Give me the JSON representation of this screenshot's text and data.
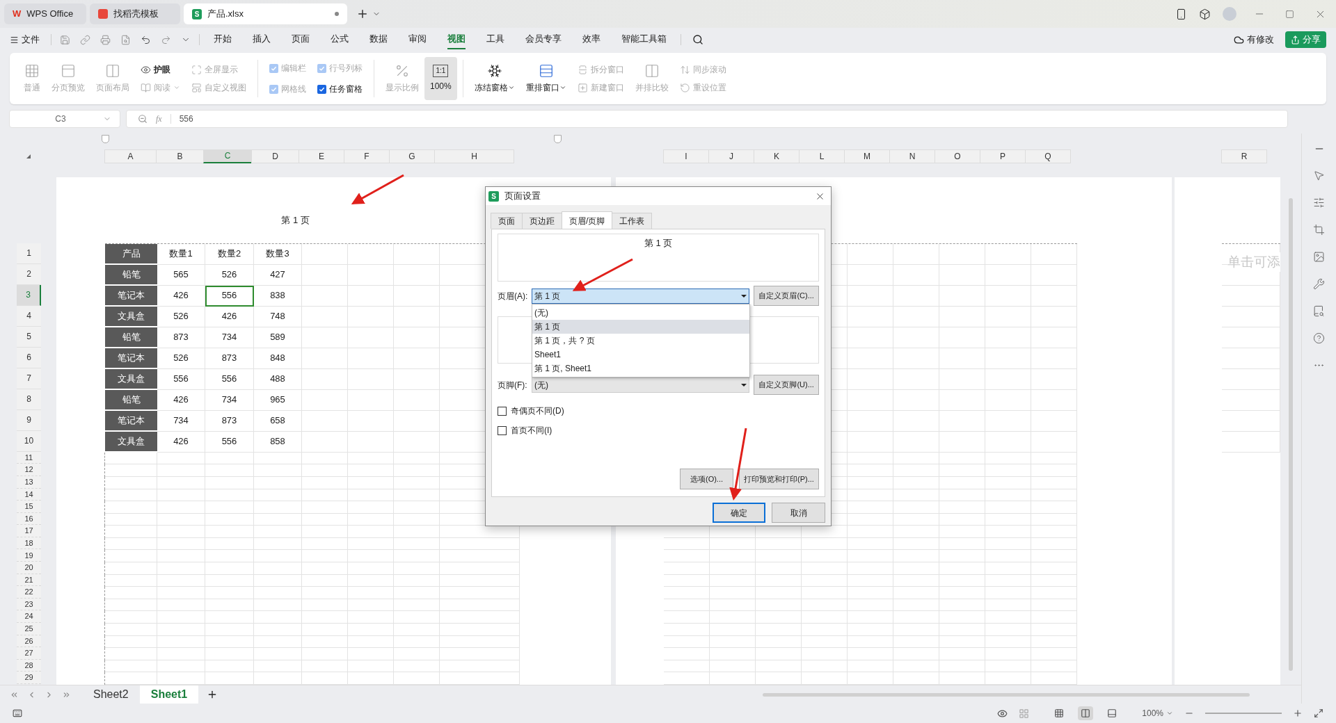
{
  "title_tabs": [
    {
      "label": "WPS Office",
      "kind": "wps",
      "logo": "W",
      "selected": false
    },
    {
      "label": "找稻壳模板",
      "kind": "docer",
      "selected": false
    },
    {
      "label": "产品.xlsx",
      "kind": "sheet",
      "logo": "S",
      "selected": true
    }
  ],
  "menu": {
    "file": "文件",
    "items": [
      {
        "label": "开始",
        "selected": false
      },
      {
        "label": "插入",
        "selected": false
      },
      {
        "label": "页面",
        "selected": false
      },
      {
        "label": "公式",
        "selected": false
      },
      {
        "label": "数据",
        "selected": false
      },
      {
        "label": "审阅",
        "selected": false
      },
      {
        "label": "视图",
        "selected": true
      },
      {
        "label": "工具",
        "selected": false
      },
      {
        "label": "会员专享",
        "selected": false
      },
      {
        "label": "效率",
        "selected": false
      },
      {
        "label": "智能工具箱",
        "selected": false
      }
    ],
    "save_status": "有修改",
    "share": "分享"
  },
  "ribbon": [
    [
      {
        "kind": "big",
        "label": "普通",
        "disabled": true,
        "selected": false
      },
      {
        "kind": "big",
        "label": "分页预览",
        "disabled": true,
        "selected": false
      },
      {
        "kind": "big",
        "label": "页面布局",
        "disabled": true,
        "selected": false
      },
      {
        "kind": "stack",
        "rows": [
          {
            "label": "护眼",
            "disabled": false,
            "dropdown": false
          },
          {
            "label": "阅读",
            "disabled": true,
            "dropdown": true
          }
        ]
      },
      {
        "kind": "stack",
        "rows": [
          {
            "label": "全屏显示",
            "disabled": true,
            "dropdown": false
          },
          {
            "label": "自定义视图",
            "disabled": true,
            "dropdown": false
          }
        ]
      }
    ],
    [
      {
        "kind": "checks",
        "rows": [
          {
            "label": "编辑栏",
            "checked": true,
            "disabled": true
          },
          {
            "label": "网格线",
            "checked": true,
            "disabled": true
          }
        ]
      },
      {
        "kind": "checks",
        "rows": [
          {
            "label": "行号列标",
            "checked": true,
            "disabled": true
          },
          {
            "label": "任务窗格",
            "checked": true,
            "disabled": false
          }
        ]
      }
    ],
    [
      {
        "kind": "big",
        "label": "显示比例",
        "disabled": true,
        "selected": false
      },
      {
        "kind": "big",
        "icon_text": "1:1",
        "label": "100%",
        "disabled": false,
        "selected": true
      }
    ],
    [
      {
        "kind": "big",
        "label": "冻结窗格",
        "disabled": false,
        "selected": false,
        "dropdown": true
      },
      {
        "kind": "big",
        "label": "重排窗口",
        "disabled": false,
        "selected": false,
        "dropdown": true
      },
      {
        "kind": "stack",
        "rows": [
          {
            "label": "拆分窗口",
            "disabled": true,
            "dropdown": false
          },
          {
            "label": "新建窗口",
            "disabled": true,
            "dropdown": false
          }
        ]
      },
      {
        "kind": "big",
        "label": "并排比较",
        "disabled": true,
        "selected": false
      },
      {
        "kind": "stack",
        "rows": [
          {
            "label": "同步滚动",
            "disabled": true,
            "dropdown": false
          },
          {
            "label": "重设位置",
            "disabled": true,
            "dropdown": false
          }
        ]
      }
    ]
  ],
  "name_box": "C3",
  "formula_label": "fx",
  "formula": "556",
  "columns_left": [
    {
      "label": "A",
      "selected": false
    },
    {
      "label": "B",
      "selected": false
    },
    {
      "label": "C",
      "selected": true
    },
    {
      "label": "D",
      "selected": false
    },
    {
      "label": "E",
      "selected": false
    },
    {
      "label": "F",
      "selected": false
    },
    {
      "label": "G",
      "selected": false
    },
    {
      "label": "H",
      "selected": false
    }
  ],
  "columns_right": [
    {
      "label": "I",
      "selected": false
    },
    {
      "label": "J",
      "selected": false
    },
    {
      "label": "K",
      "selected": false
    },
    {
      "label": "L",
      "selected": false
    },
    {
      "label": "M",
      "selected": false
    },
    {
      "label": "N",
      "selected": false
    },
    {
      "label": "O",
      "selected": false
    },
    {
      "label": "P",
      "selected": false
    },
    {
      "label": "Q",
      "selected": false
    }
  ],
  "columns_far": [
    {
      "label": "R",
      "selected": false
    }
  ],
  "page_header": "第 1 页",
  "far_page_hint": "单击可添",
  "rows": [
    {
      "num": "1",
      "selected": false,
      "cells": [
        {
          "text": "产品",
          "selected": false
        },
        {
          "text": "数量1",
          "selected": false
        },
        {
          "text": "数量2",
          "selected": false
        },
        {
          "text": "数量3",
          "selected": false
        }
      ]
    },
    {
      "num": "2",
      "selected": false,
      "cells": [
        {
          "text": "铅笔",
          "selected": false
        },
        {
          "text": "565",
          "selected": false
        },
        {
          "text": "526",
          "selected": false
        },
        {
          "text": "427",
          "selected": false
        }
      ]
    },
    {
      "num": "3",
      "selected": true,
      "cells": [
        {
          "text": "笔记本",
          "selected": false
        },
        {
          "text": "426",
          "selected": false
        },
        {
          "text": "556",
          "selected": true
        },
        {
          "text": "838",
          "selected": false
        }
      ]
    },
    {
      "num": "4",
      "selected": false,
      "cells": [
        {
          "text": "文具盒",
          "selected": false
        },
        {
          "text": "526",
          "selected": false
        },
        {
          "text": "426",
          "selected": false
        },
        {
          "text": "748",
          "selected": false
        }
      ]
    },
    {
      "num": "5",
      "selected": false,
      "cells": [
        {
          "text": "铅笔",
          "selected": false
        },
        {
          "text": "873",
          "selected": false
        },
        {
          "text": "734",
          "selected": false
        },
        {
          "text": "589",
          "selected": false
        }
      ]
    },
    {
      "num": "6",
      "selected": false,
      "cells": [
        {
          "text": "笔记本",
          "selected": false
        },
        {
          "text": "526",
          "selected": false
        },
        {
          "text": "873",
          "selected": false
        },
        {
          "text": "848",
          "selected": false
        }
      ]
    },
    {
      "num": "7",
      "selected": false,
      "cells": [
        {
          "text": "文具盒",
          "selected": false
        },
        {
          "text": "556",
          "selected": false
        },
        {
          "text": "556",
          "selected": false
        },
        {
          "text": "488",
          "selected": false
        }
      ]
    },
    {
      "num": "8",
      "selected": false,
      "cells": [
        {
          "text": "铅笔",
          "selected": false
        },
        {
          "text": "426",
          "selected": false
        },
        {
          "text": "734",
          "selected": false
        },
        {
          "text": "965",
          "selected": false
        }
      ]
    },
    {
      "num": "9",
      "selected": false,
      "cells": [
        {
          "text": "笔记本",
          "selected": false
        },
        {
          "text": "734",
          "selected": false
        },
        {
          "text": "873",
          "selected": false
        },
        {
          "text": "658",
          "selected": false
        }
      ]
    },
    {
      "num": "10",
      "selected": false,
      "cells": [
        {
          "text": "文具盒",
          "selected": false
        },
        {
          "text": "426",
          "selected": false
        },
        {
          "text": "556",
          "selected": false
        },
        {
          "text": "858",
          "selected": false
        }
      ]
    }
  ],
  "empty_rows": [
    {
      "num": "11",
      "selected": false
    },
    {
      "num": "12",
      "selected": false
    },
    {
      "num": "13",
      "selected": false
    },
    {
      "num": "14",
      "selected": false
    },
    {
      "num": "15",
      "selected": false
    },
    {
      "num": "16",
      "selected": false
    },
    {
      "num": "17",
      "selected": false
    },
    {
      "num": "18",
      "selected": false
    },
    {
      "num": "19",
      "selected": false
    },
    {
      "num": "20",
      "selected": false
    },
    {
      "num": "21",
      "selected": false
    },
    {
      "num": "22",
      "selected": false
    },
    {
      "num": "23",
      "selected": false
    },
    {
      "num": "24",
      "selected": false
    },
    {
      "num": "25",
      "selected": false
    },
    {
      "num": "26",
      "selected": false
    },
    {
      "num": "27",
      "selected": false
    },
    {
      "num": "28",
      "selected": false
    },
    {
      "num": "29",
      "selected": false
    }
  ],
  "dialog": {
    "logo": "S",
    "title": "页面设置",
    "tabs": [
      {
        "label": "页面",
        "selected": false
      },
      {
        "label": "页边距",
        "selected": false
      },
      {
        "label": "页眉/页脚",
        "selected": true
      },
      {
        "label": "工作表",
        "selected": false
      }
    ],
    "header_preview": "第 1 页",
    "header_label": "页眉(A):",
    "header_value": "第 1 页",
    "header_expanded": true,
    "header_options": [
      {
        "label": "(无)",
        "selected": false
      },
      {
        "label": "第 1 页",
        "selected": true
      },
      {
        "label": "第 1 页，共 ? 页",
        "selected": false
      },
      {
        "label": "Sheet1",
        "selected": false
      },
      {
        "label": "第 1 页, Sheet1",
        "selected": false
      }
    ],
    "custom_header": "自定义页眉(C)...",
    "footer_label": "页脚(F):",
    "footer_value": "(无)",
    "custom_footer": "自定义页脚(U)...",
    "checkboxes": [
      {
        "label": "奇偶页不同(D)",
        "checked": false
      },
      {
        "label": "首页不同(I)",
        "checked": false
      }
    ],
    "options": "选项(O)...",
    "print": "打印预览和打印(P)...",
    "ok": "确定",
    "cancel": "取消"
  },
  "sheet_tabs": [
    {
      "label": "Sheet2",
      "selected": false
    },
    {
      "label": "Sheet1",
      "selected": true
    }
  ],
  "status": {
    "zoom": "100%",
    "views": [
      {
        "kind": "normal",
        "selected": false
      },
      {
        "kind": "page",
        "selected": true
      },
      {
        "kind": "break",
        "selected": false
      }
    ]
  }
}
